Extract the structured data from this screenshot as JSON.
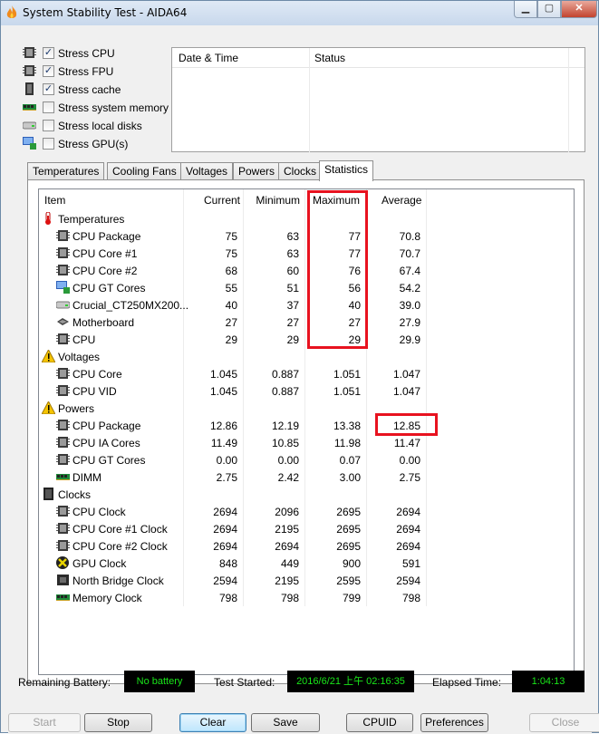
{
  "window": {
    "title": "System Stability Test - AIDA64",
    "controls": [
      "minimize",
      "maximize",
      "close"
    ]
  },
  "stress_options": [
    {
      "label": "Stress CPU",
      "checked": true,
      "icon": "cpu-chip-icon"
    },
    {
      "label": "Stress FPU",
      "checked": true,
      "icon": "cpu-chip-icon"
    },
    {
      "label": "Stress cache",
      "checked": true,
      "icon": "cache-chip-icon"
    },
    {
      "label": "Stress system memory",
      "checked": false,
      "icon": "memory-module-icon"
    },
    {
      "label": "Stress local disks",
      "checked": false,
      "icon": "disk-drive-icon"
    },
    {
      "label": "Stress GPU(s)",
      "checked": false,
      "icon": "monitor-gpu-icon"
    }
  ],
  "status_list": {
    "columns": [
      "Date & Time",
      "Status"
    ],
    "rows": []
  },
  "tabs": [
    {
      "label": "Temperatures",
      "active": false
    },
    {
      "label": "Cooling Fans",
      "active": false
    },
    {
      "label": "Voltages",
      "active": false
    },
    {
      "label": "Powers",
      "active": false
    },
    {
      "label": "Clocks",
      "active": false
    },
    {
      "label": "Statistics",
      "active": true
    }
  ],
  "stats": {
    "columns": [
      "Item",
      "Current",
      "Minimum",
      "Maximum",
      "Average"
    ],
    "rows": [
      {
        "kind": "group",
        "label": "Temperatures",
        "icon": "thermometer-icon"
      },
      {
        "kind": "item",
        "label": "CPU Package",
        "icon": "cpu-chip-icon",
        "current": "75",
        "minimum": "63",
        "maximum": "77",
        "average": "70.8"
      },
      {
        "kind": "item",
        "label": "CPU Core #1",
        "icon": "cpu-chip-icon",
        "current": "75",
        "minimum": "63",
        "maximum": "77",
        "average": "70.7"
      },
      {
        "kind": "item",
        "label": "CPU Core #2",
        "icon": "cpu-chip-icon",
        "current": "68",
        "minimum": "60",
        "maximum": "76",
        "average": "67.4"
      },
      {
        "kind": "item",
        "label": "CPU GT Cores",
        "icon": "monitor-gpu-icon",
        "current": "55",
        "minimum": "51",
        "maximum": "56",
        "average": "54.2"
      },
      {
        "kind": "item",
        "label": "Crucial_CT250MX200...",
        "icon": "disk-drive-icon",
        "current": "40",
        "minimum": "37",
        "maximum": "40",
        "average": "39.0"
      },
      {
        "kind": "item",
        "label": "Motherboard",
        "icon": "motherboard-icon",
        "current": "27",
        "minimum": "27",
        "maximum": "27",
        "average": "27.9"
      },
      {
        "kind": "item",
        "label": "CPU",
        "icon": "cpu-chip-icon",
        "current": "29",
        "minimum": "29",
        "maximum": "29",
        "average": "29.9"
      },
      {
        "kind": "group",
        "label": "Voltages",
        "icon": "warning-triangle-icon"
      },
      {
        "kind": "item",
        "label": "CPU Core",
        "icon": "cpu-chip-icon",
        "current": "1.045",
        "minimum": "0.887",
        "maximum": "1.051",
        "average": "1.047"
      },
      {
        "kind": "item",
        "label": "CPU VID",
        "icon": "cpu-chip-icon",
        "current": "1.045",
        "minimum": "0.887",
        "maximum": "1.051",
        "average": "1.047"
      },
      {
        "kind": "group",
        "label": "Powers",
        "icon": "warning-triangle-icon"
      },
      {
        "kind": "item",
        "label": "CPU Package",
        "icon": "cpu-chip-icon",
        "current": "12.86",
        "minimum": "12.19",
        "maximum": "13.38",
        "average": "12.85"
      },
      {
        "kind": "item",
        "label": "CPU IA Cores",
        "icon": "cpu-chip-icon",
        "current": "11.49",
        "minimum": "10.85",
        "maximum": "11.98",
        "average": "11.47"
      },
      {
        "kind": "item",
        "label": "CPU GT Cores",
        "icon": "cpu-chip-icon",
        "current": "0.00",
        "minimum": "0.00",
        "maximum": "0.07",
        "average": "0.00"
      },
      {
        "kind": "item",
        "label": "DIMM",
        "icon": "memory-module-icon",
        "current": "2.75",
        "minimum": "2.42",
        "maximum": "3.00",
        "average": "2.75"
      },
      {
        "kind": "group",
        "label": "Clocks",
        "icon": "clock-chip-icon"
      },
      {
        "kind": "item",
        "label": "CPU Clock",
        "icon": "cpu-chip-icon",
        "current": "2694",
        "minimum": "2096",
        "maximum": "2695",
        "average": "2694"
      },
      {
        "kind": "item",
        "label": "CPU Core #1 Clock",
        "icon": "cpu-chip-icon",
        "current": "2694",
        "minimum": "2195",
        "maximum": "2695",
        "average": "2694"
      },
      {
        "kind": "item",
        "label": "CPU Core #2 Clock",
        "icon": "cpu-chip-icon",
        "current": "2694",
        "minimum": "2694",
        "maximum": "2695",
        "average": "2694"
      },
      {
        "kind": "item",
        "label": "GPU Clock",
        "icon": "xbox-gpu-icon",
        "current": "848",
        "minimum": "449",
        "maximum": "900",
        "average": "591"
      },
      {
        "kind": "item",
        "label": "North Bridge Clock",
        "icon": "chip-icon",
        "current": "2594",
        "minimum": "2195",
        "maximum": "2595",
        "average": "2594"
      },
      {
        "kind": "item",
        "label": "Memory Clock",
        "icon": "memory-module-icon",
        "current": "798",
        "minimum": "798",
        "maximum": "799",
        "average": "798"
      }
    ]
  },
  "status_bar": {
    "battery_label": "Remaining Battery:",
    "battery_value": "No battery",
    "started_label": "Test Started:",
    "started_value": "2016/6/21 上午 02:16:35",
    "elapsed_label": "Elapsed Time:",
    "elapsed_value": "1:04:13"
  },
  "buttons": [
    {
      "label": "Start",
      "enabled": false,
      "default": false,
      "name": "start-button"
    },
    {
      "label": "Stop",
      "enabled": true,
      "default": false,
      "name": "stop-button"
    },
    {
      "label": "Clear",
      "enabled": true,
      "default": true,
      "name": "clear-button"
    },
    {
      "label": "Save",
      "enabled": true,
      "default": false,
      "name": "save-button"
    },
    {
      "label": "CPUID",
      "enabled": true,
      "default": false,
      "name": "cpuid-button"
    },
    {
      "label": "Preferences",
      "enabled": true,
      "default": false,
      "name": "preferences-button"
    },
    {
      "label": "Close",
      "enabled": false,
      "default": false,
      "name": "close-button"
    }
  ],
  "colors": {
    "highlight": "#e8121f",
    "led_text": "#19e619",
    "led_bg": "#000000"
  }
}
